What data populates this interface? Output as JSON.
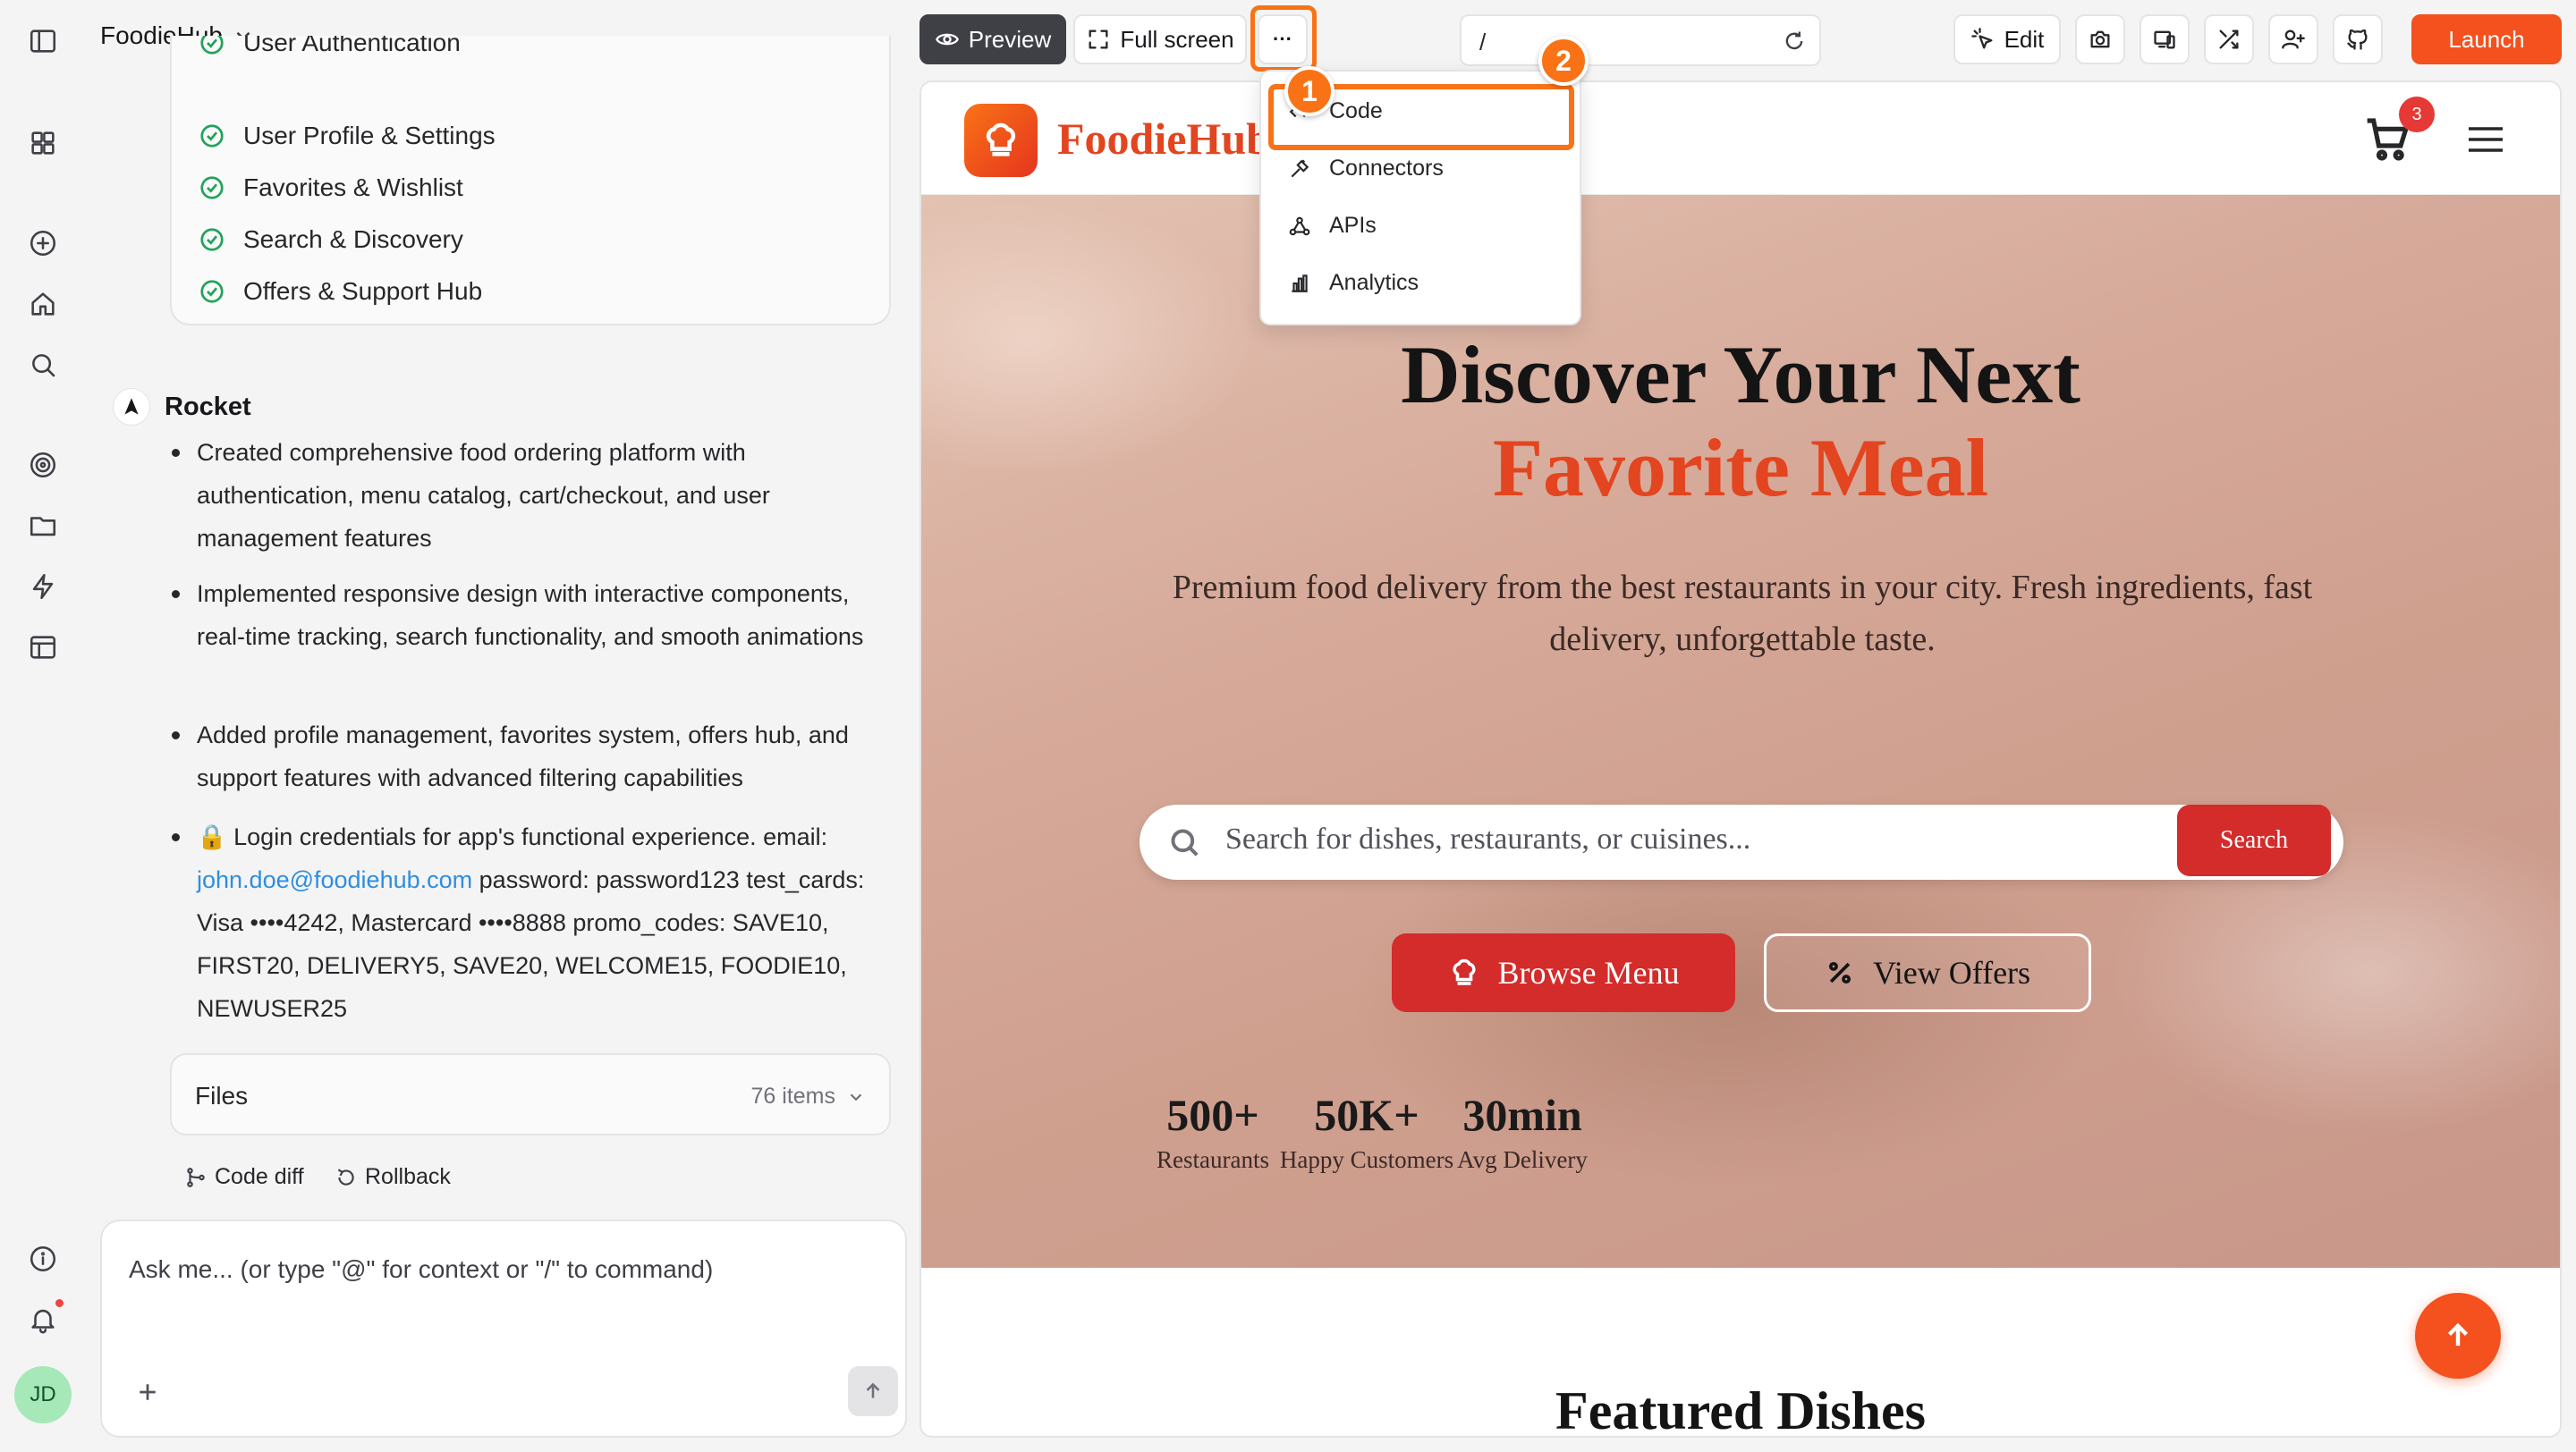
{
  "app": {
    "project_name": "FoodieHub"
  },
  "features": {
    "partial_item": "User Authentication",
    "items": [
      "User Profile & Settings",
      "Favorites & Wishlist",
      "Search & Discovery",
      "Offers & Support Hub"
    ]
  },
  "message": {
    "author": "Rocket",
    "bullets": [
      "Created comprehensive food ordering platform with authentication, menu catalog, cart/checkout, and user management features",
      "Implemented responsive design with interactive components, real-time tracking, search functionality, and smooth animations",
      "Added profile management, favorites system, offers hub, and support features with advanced filtering capabilities"
    ],
    "credentials": {
      "lock_icon": "🔒",
      "intro": "Login credentials for app's functional experience. email:",
      "email": "john.doe@foodiehub.com",
      "rest": "password: password123 test_cards: Visa ••••4242, Mastercard ••••8888 promo_codes: SAVE10, FIRST20, DELIVERY5, SAVE20, WELCOME15, FOODIE10, NEWUSER25"
    }
  },
  "files": {
    "label": "Files",
    "count": "76 items"
  },
  "actions": {
    "code_diff": "Code diff",
    "rollback": "Rollback"
  },
  "composer": {
    "placeholder": "Ask me... (or type \"@\" for context or \"/\" to command)"
  },
  "toolbar": {
    "preview": "Preview",
    "full_screen": "Full screen",
    "more": "···",
    "url": "/",
    "edit": "Edit",
    "launch": "Launch"
  },
  "dropdown": {
    "items": [
      "Code",
      "Connectors",
      "APIs",
      "Analytics"
    ]
  },
  "annotations": {
    "step1": "1",
    "step2": "2",
    "highlight_color": "#f97316"
  },
  "site": {
    "name": "FoodieHub",
    "cart_count": "3",
    "hero_title_line1": "Discover Your Next",
    "hero_title_line2": "Favorite Meal",
    "hero_subtitle": "Premium food delivery from the best restaurants in your city. Fresh ingredients, fast delivery, unforgettable taste.",
    "search_placeholder": "Search for dishes, restaurants, or cuisines...",
    "search_button": "Search",
    "browse_menu": "Browse Menu",
    "view_offers": "View Offers",
    "stats": [
      {
        "value": "500+",
        "label": "Restaurants"
      },
      {
        "value": "50K+",
        "label": "Happy Customers"
      },
      {
        "value": "30min",
        "label": "Avg Delivery"
      }
    ],
    "featured_heading": "Featured Dishes",
    "brand_color": "#e2451f",
    "button_color": "#d42b2b"
  }
}
